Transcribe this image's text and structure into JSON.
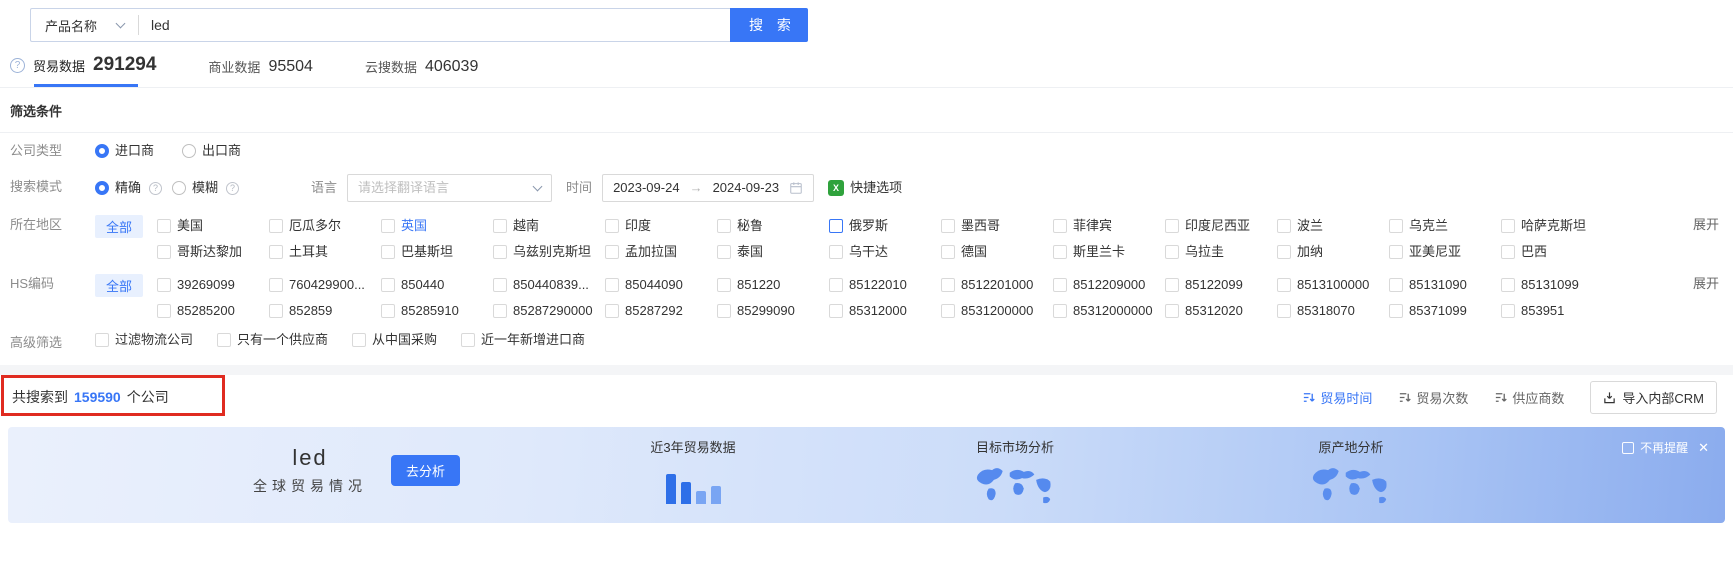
{
  "search": {
    "category": "产品名称",
    "value": "led",
    "button": "搜 索"
  },
  "tabs": [
    {
      "label": "贸易数据",
      "count": "291294"
    },
    {
      "label": "商业数据",
      "count": "95504"
    },
    {
      "label": "云搜数据",
      "count": "406039"
    }
  ],
  "filter": {
    "section_title": "筛选条件",
    "company_type": {
      "label": "公司类型",
      "importer": "进口商",
      "exporter": "出口商"
    },
    "search_mode": {
      "label": "搜索模式",
      "exact": "精确",
      "fuzzy": "模糊",
      "language_label": "语言",
      "language_placeholder": "请选择翻译语言",
      "time_label": "时间",
      "date_start": "2023-09-24",
      "date_arrow": "→",
      "date_end": "2024-09-23",
      "quick_option": "快捷选项"
    },
    "region": {
      "label": "所在地区",
      "all": "全部",
      "expand": "展开",
      "row1": [
        "美国",
        "厄瓜多尔",
        "英国",
        "越南",
        "印度",
        "秘鲁",
        "俄罗斯",
        "墨西哥",
        "菲律宾",
        "印度尼西亚",
        "波兰",
        "乌克兰",
        "哈萨克斯坦"
      ],
      "row2": [
        "哥斯达黎加",
        "土耳其",
        "巴基斯坦",
        "乌兹别克斯坦",
        "孟加拉国",
        "泰国",
        "乌干达",
        "德国",
        "斯里兰卡",
        "乌拉圭",
        "加纳",
        "亚美尼亚",
        "巴西"
      ]
    },
    "hs_code": {
      "label": "HS编码",
      "all": "全部",
      "expand": "展开",
      "row1": [
        "39269099",
        "760429900...",
        "850440",
        "850440839...",
        "85044090",
        "851220",
        "85122010",
        "8512201000",
        "8512209000",
        "85122099",
        "8513100000",
        "85131090",
        "85131099"
      ],
      "row2": [
        "85285200",
        "852859",
        "85285910",
        "85287290000",
        "85287292",
        "85299090",
        "85312000",
        "8531200000",
        "85312000000",
        "85312020",
        "85318070",
        "85371099",
        "853951"
      ]
    },
    "advanced": {
      "label": "高级筛选",
      "options": [
        "过滤物流公司",
        "只有一个供应商",
        "从中国采购",
        "近一年新增进口商"
      ]
    }
  },
  "results": {
    "prefix": "共搜索到",
    "count": "159590",
    "suffix": "个公司",
    "sorts": [
      "贸易时间",
      "贸易次数",
      "供应商数"
    ],
    "crm_button": "导入内部CRM"
  },
  "banner": {
    "keyword": "led",
    "subtitle": "全球贸易情况",
    "analyze": "去分析",
    "trade_title": "近3年贸易数据",
    "market_title": "目标市场分析",
    "origin_title": "原产地分析",
    "dismiss": "不再提醒"
  },
  "colors": {
    "primary": "#3876f6",
    "annotation_red": "#e02b20",
    "banner_map": "#4c84ee"
  }
}
